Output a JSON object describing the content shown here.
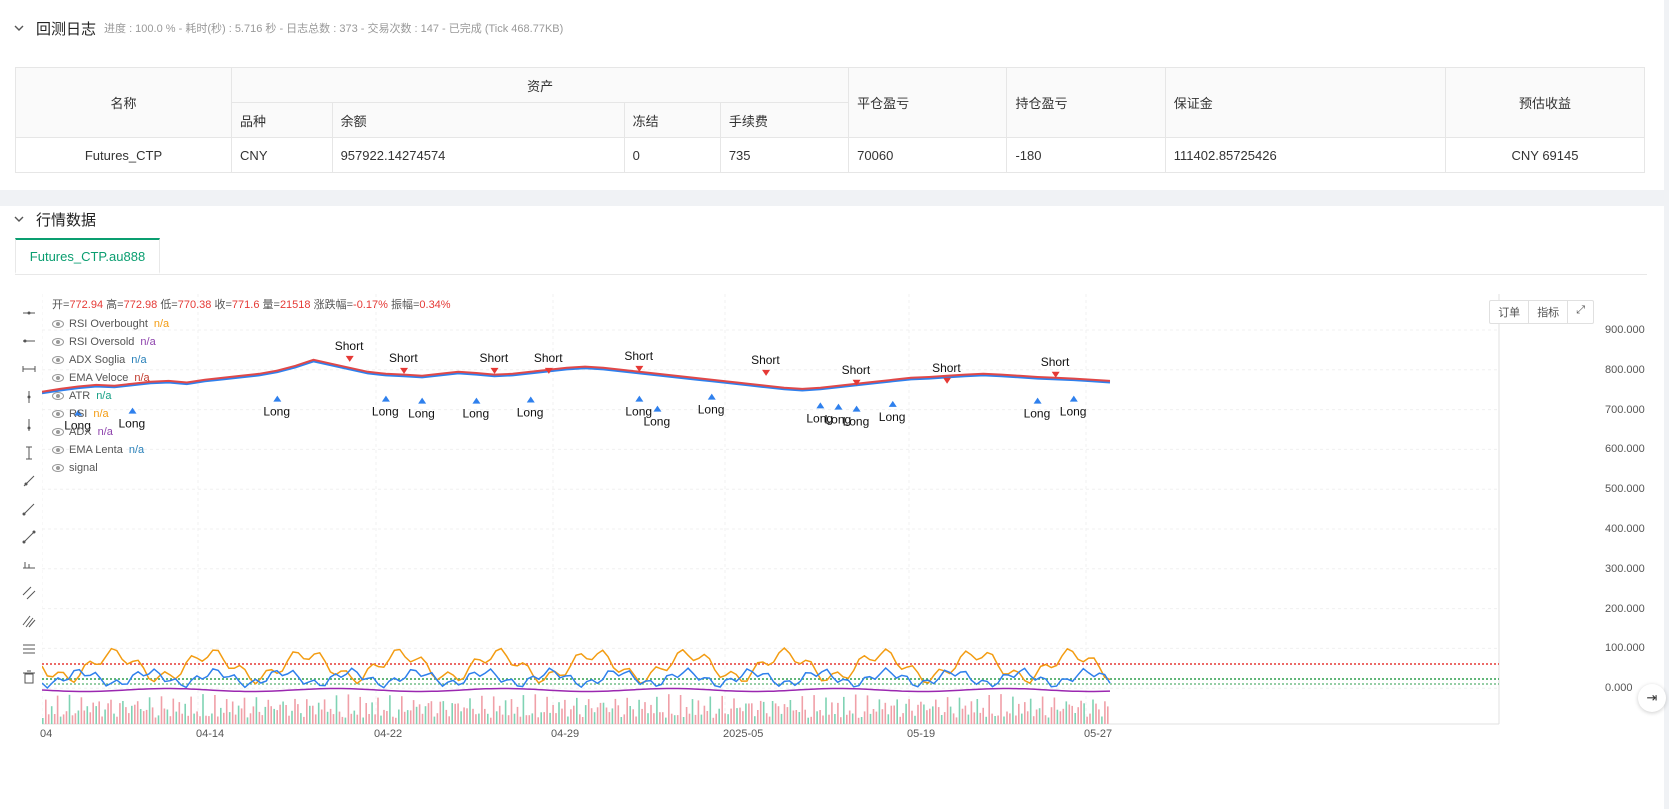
{
  "log": {
    "title": "回测日志",
    "subtitle": "进度 : 100.0 % - 耗时(秒) : 5.716  秒 - 日志总数 : 373 - 交易次数 : 147 - 已完成 (Tick 468.77KB)"
  },
  "assets_table": {
    "headers": {
      "name": "名称",
      "assets": "资产",
      "symbol": "品种",
      "balance": "余额",
      "frozen": "冻结",
      "fee": "手续费",
      "close_pnl": "平仓盈亏",
      "position_pnl": "持仓盈亏",
      "margin": "保证金",
      "est_profit": "预估收益"
    },
    "row": {
      "name": "Futures_CTP",
      "symbol": "CNY",
      "balance": "957922.14274574",
      "frozen": "0",
      "fee": "735",
      "close_pnl": "70060",
      "position_pnl": "-180",
      "margin": "111402.85725426",
      "est_profit": "CNY 69145"
    }
  },
  "market": {
    "title": "行情数据",
    "tab": "Futures_CTP.au888"
  },
  "ohlc": {
    "open_label": "开=",
    "open": "772.94",
    "high_label": "高=",
    "high": "772.98",
    "low_label": "低=",
    "low": "770.38",
    "close_label": "收=",
    "close": "771.6",
    "vol_label": "量=",
    "vol": "21518",
    "chg_label": "涨跌幅=",
    "chg": "-0.17%",
    "amp_label": "振幅=",
    "amp": "0.34%"
  },
  "legend": [
    {
      "name": "RSI Overbought",
      "value": "n/a",
      "color": "#f39c12"
    },
    {
      "name": "RSI Oversold",
      "value": "n/a",
      "color": "#8e44ad"
    },
    {
      "name": "ADX Soglia",
      "value": "n/a",
      "color": "#2980b9"
    },
    {
      "name": "EMA Veloce",
      "value": "n/a",
      "color": "#c0392b"
    },
    {
      "name": "ATR",
      "value": "n/a",
      "color": "#16a085"
    },
    {
      "name": "RSI",
      "value": "n/a",
      "color": "#f39c12"
    },
    {
      "name": "ADX",
      "value": "n/a",
      "color": "#8e44ad"
    },
    {
      "name": "EMA Lenta",
      "value": "n/a",
      "color": "#2980b9"
    },
    {
      "name": "signal",
      "value": "",
      "color": "#555"
    }
  ],
  "chart_buttons": {
    "order": "订单",
    "indicator": "指标"
  },
  "chart_data": {
    "type": "line",
    "y_ticks": [
      "900.000",
      "800.000",
      "700.000",
      "600.000",
      "500.000",
      "400.000",
      "300.000",
      "200.000",
      "100.000",
      "0.000"
    ],
    "x_ticks": [
      "04",
      "04-14",
      "04-22",
      "04-29",
      "2025-05",
      "05-19",
      "05-27"
    ],
    "signal_labels": {
      "long": "Long",
      "short": "Short"
    },
    "price": [
      745,
      752,
      758,
      762,
      760,
      765,
      770,
      772,
      768,
      775,
      780,
      785,
      790,
      798,
      810,
      825,
      815,
      805,
      795,
      790,
      788,
      785,
      790,
      795,
      792,
      788,
      790,
      795,
      800,
      805,
      808,
      805,
      800,
      795,
      790,
      785,
      780,
      775,
      770,
      765,
      760,
      755,
      752,
      755,
      760,
      765,
      770,
      775,
      780,
      782,
      785,
      788,
      790,
      788,
      785,
      782,
      780,
      778,
      775,
      772
    ],
    "long_signals": [
      [
        2,
        700
      ],
      [
        5,
        705
      ],
      [
        13,
        735
      ],
      [
        19,
        735
      ],
      [
        21,
        730
      ],
      [
        24,
        730
      ],
      [
        27,
        733
      ],
      [
        33,
        735
      ],
      [
        34,
        710
      ],
      [
        37,
        740
      ],
      [
        43,
        718
      ],
      [
        44,
        715
      ],
      [
        45,
        710
      ],
      [
        47,
        722
      ],
      [
        55,
        730
      ],
      [
        57,
        735
      ]
    ],
    "short_signals": [
      [
        17,
        845
      ],
      [
        20,
        815
      ],
      [
        25,
        815
      ],
      [
        28,
        815
      ],
      [
        33,
        820
      ],
      [
        40,
        810
      ],
      [
        45,
        785
      ],
      [
        50,
        790
      ],
      [
        56,
        805
      ]
    ]
  }
}
